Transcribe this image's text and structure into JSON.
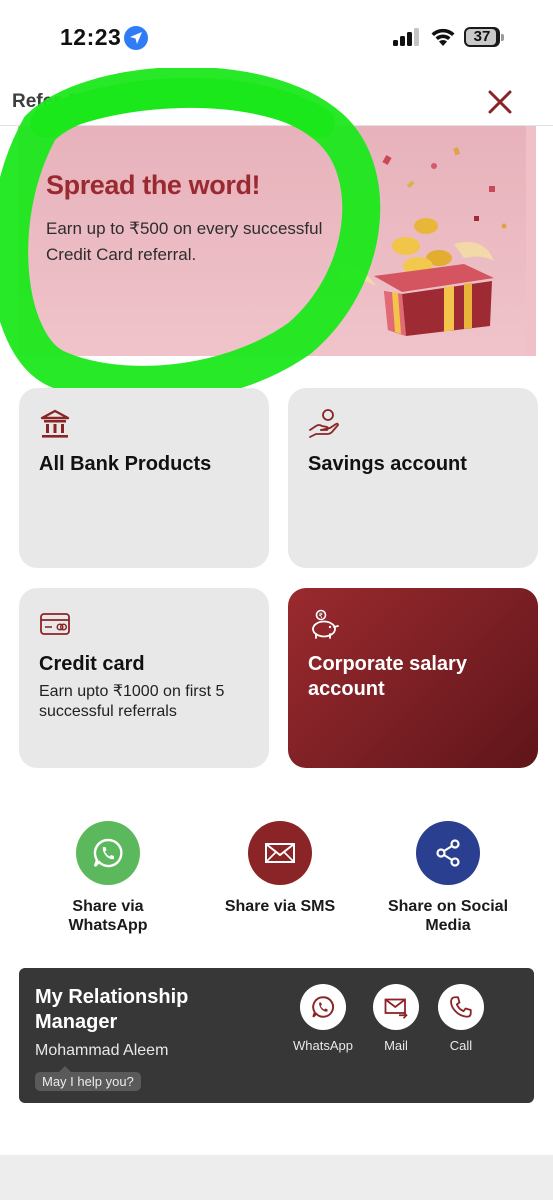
{
  "status_bar": {
    "time": "12:23",
    "battery": "37",
    "icons": [
      "location-arrow-icon",
      "cellular-signal-icon",
      "wifi-icon",
      "battery-icon"
    ]
  },
  "header": {
    "title": "Refer & Earn",
    "close_icon": "close-icon"
  },
  "banner": {
    "title": "Spread the word!",
    "subtitle": "Earn up to ₹500 on every successful Credit Card referral."
  },
  "products": [
    {
      "title": "All Bank Products",
      "description": "",
      "icon": "bank-icon"
    },
    {
      "title": "Savings account",
      "description": "",
      "icon": "hand-coin-icon"
    },
    {
      "title": "Credit card",
      "description": "Earn upto ₹1000 on first 5 successful referrals",
      "icon": "credit-card-icon"
    },
    {
      "title": "Corporate salary account",
      "description": "",
      "icon": "piggy-bank-icon"
    }
  ],
  "share": [
    {
      "label": "Share via WhatsApp",
      "icon": "whatsapp-icon",
      "color": "#5cb85c"
    },
    {
      "label": "Share via SMS",
      "icon": "envelope-icon",
      "color": "#8b2426"
    },
    {
      "label": "Share on Social Media",
      "icon": "share-icon",
      "color": "#2a3f8f"
    }
  ],
  "relationship_manager": {
    "title": "My Relationship Manager",
    "name": "Mohammad Aleem",
    "help": "May I help you?",
    "actions": [
      {
        "label": "WhatsApp",
        "icon": "whatsapp-icon"
      },
      {
        "label": "Mail",
        "icon": "mail-send-icon"
      },
      {
        "label": "Call",
        "icon": "phone-icon"
      }
    ]
  },
  "colors": {
    "brand_red": "#8b2426",
    "card_grey": "#e8e8e8",
    "rm_bg": "#373737",
    "highlight_green": "#1be81b"
  }
}
